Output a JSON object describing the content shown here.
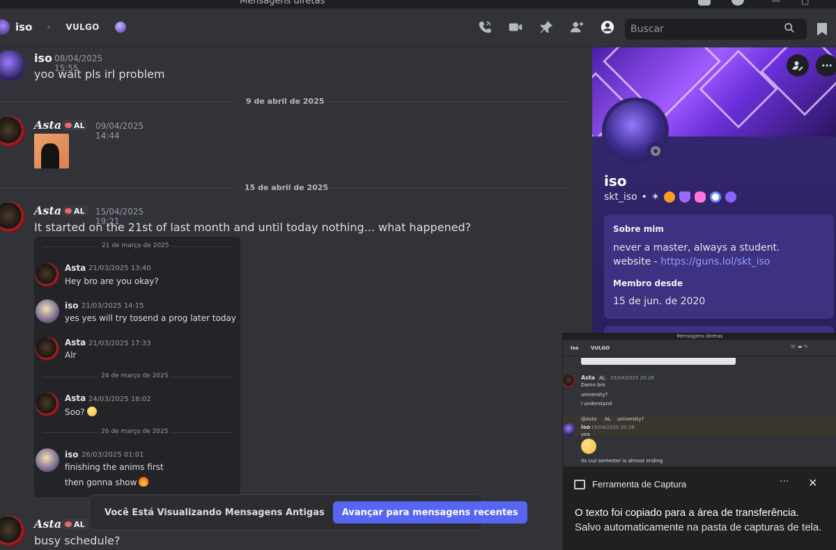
{
  "window": {
    "title": "Mensagens diretas"
  },
  "header": {
    "name": "iso",
    "tag": "VULGO",
    "search_placeholder": "Buscar"
  },
  "messages": [
    {
      "author": "iso",
      "timestamp": "08/04/2025 15:55",
      "text": "yoo wait pls irl problem"
    },
    {
      "author": "Asta",
      "badge": "AL",
      "timestamp": "09/04/2025 14:44"
    },
    {
      "author": "Asta",
      "badge": "AL",
      "timestamp": "15/04/2025 19:21",
      "text": "It started on the 21st of last month and until today nothing...  what happened?"
    },
    {
      "author": "Asta",
      "badge": "AL",
      "text": "busy schedule?"
    }
  ],
  "dividers": [
    "9 de abril de 2025",
    "15 de abril de 2025"
  ],
  "embed": {
    "dividers": [
      "21 de março de 2025",
      "24 de março de 2025",
      "26 de março de 2025"
    ],
    "messages": [
      {
        "author": "Asta",
        "timestamp": "21/03/2025 13:40",
        "lines": [
          "Hey bro are you okay?"
        ]
      },
      {
        "author": "iso",
        "timestamp": "21/03/2025 14:15",
        "lines": [
          "yes yes will try tosend a prog later today"
        ]
      },
      {
        "author": "Asta",
        "timestamp": "21/03/2025 17:33",
        "lines": [
          "Alr"
        ]
      },
      {
        "author": "Asta",
        "timestamp": "24/03/2025 16:02",
        "lines": [
          "Soo?"
        ]
      },
      {
        "author": "iso",
        "timestamp": "26/03/2025 01:01",
        "lines": [
          "finishing the anims first",
          "then gonna show"
        ]
      }
    ]
  },
  "old_messages_bar": {
    "text": "Você Está Visualizando Mensagens Antigas",
    "button": "Avançar para mensagens recentes"
  },
  "profile": {
    "display_name": "iso",
    "username": "skt_iso",
    "about_heading": "Sobre mim",
    "about_line1": "never a master, always a student.",
    "about_line2_prefix": "website - ",
    "about_link": "https://guns.lol/skt_iso",
    "member_since_heading": "Membro desde",
    "member_since": "15 de jun. de 2020",
    "status_color": "#80848e"
  },
  "mini_screenshot": {
    "title": "Mensagens diretas",
    "header_name": "iso",
    "header_tag": "VULGO",
    "msg1_author": "Asta",
    "msg1_badge": "AL",
    "msg1_ts": "15/04/2025 20:28",
    "msg1_lines": [
      "Damn bro",
      "university?",
      "I understand"
    ],
    "reply_text": "@Asta",
    "reply_badge": "AL",
    "reply_quote": "university?",
    "msg2_author": "iso",
    "msg2_ts": "15/04/2025 20:28",
    "msg2_line1": "yea",
    "msg2_line2": "its cuz semester is almost ending"
  },
  "toast": {
    "app": "Ferramenta de Captura",
    "more": "···",
    "line1": "O texto foi copiado para a área de transferência.",
    "line2": "Salvo automaticamente na pasta de capturas de tela."
  },
  "colors": {
    "accent": "#5865f2",
    "link": "#8ea1ff",
    "background": "#323339"
  }
}
